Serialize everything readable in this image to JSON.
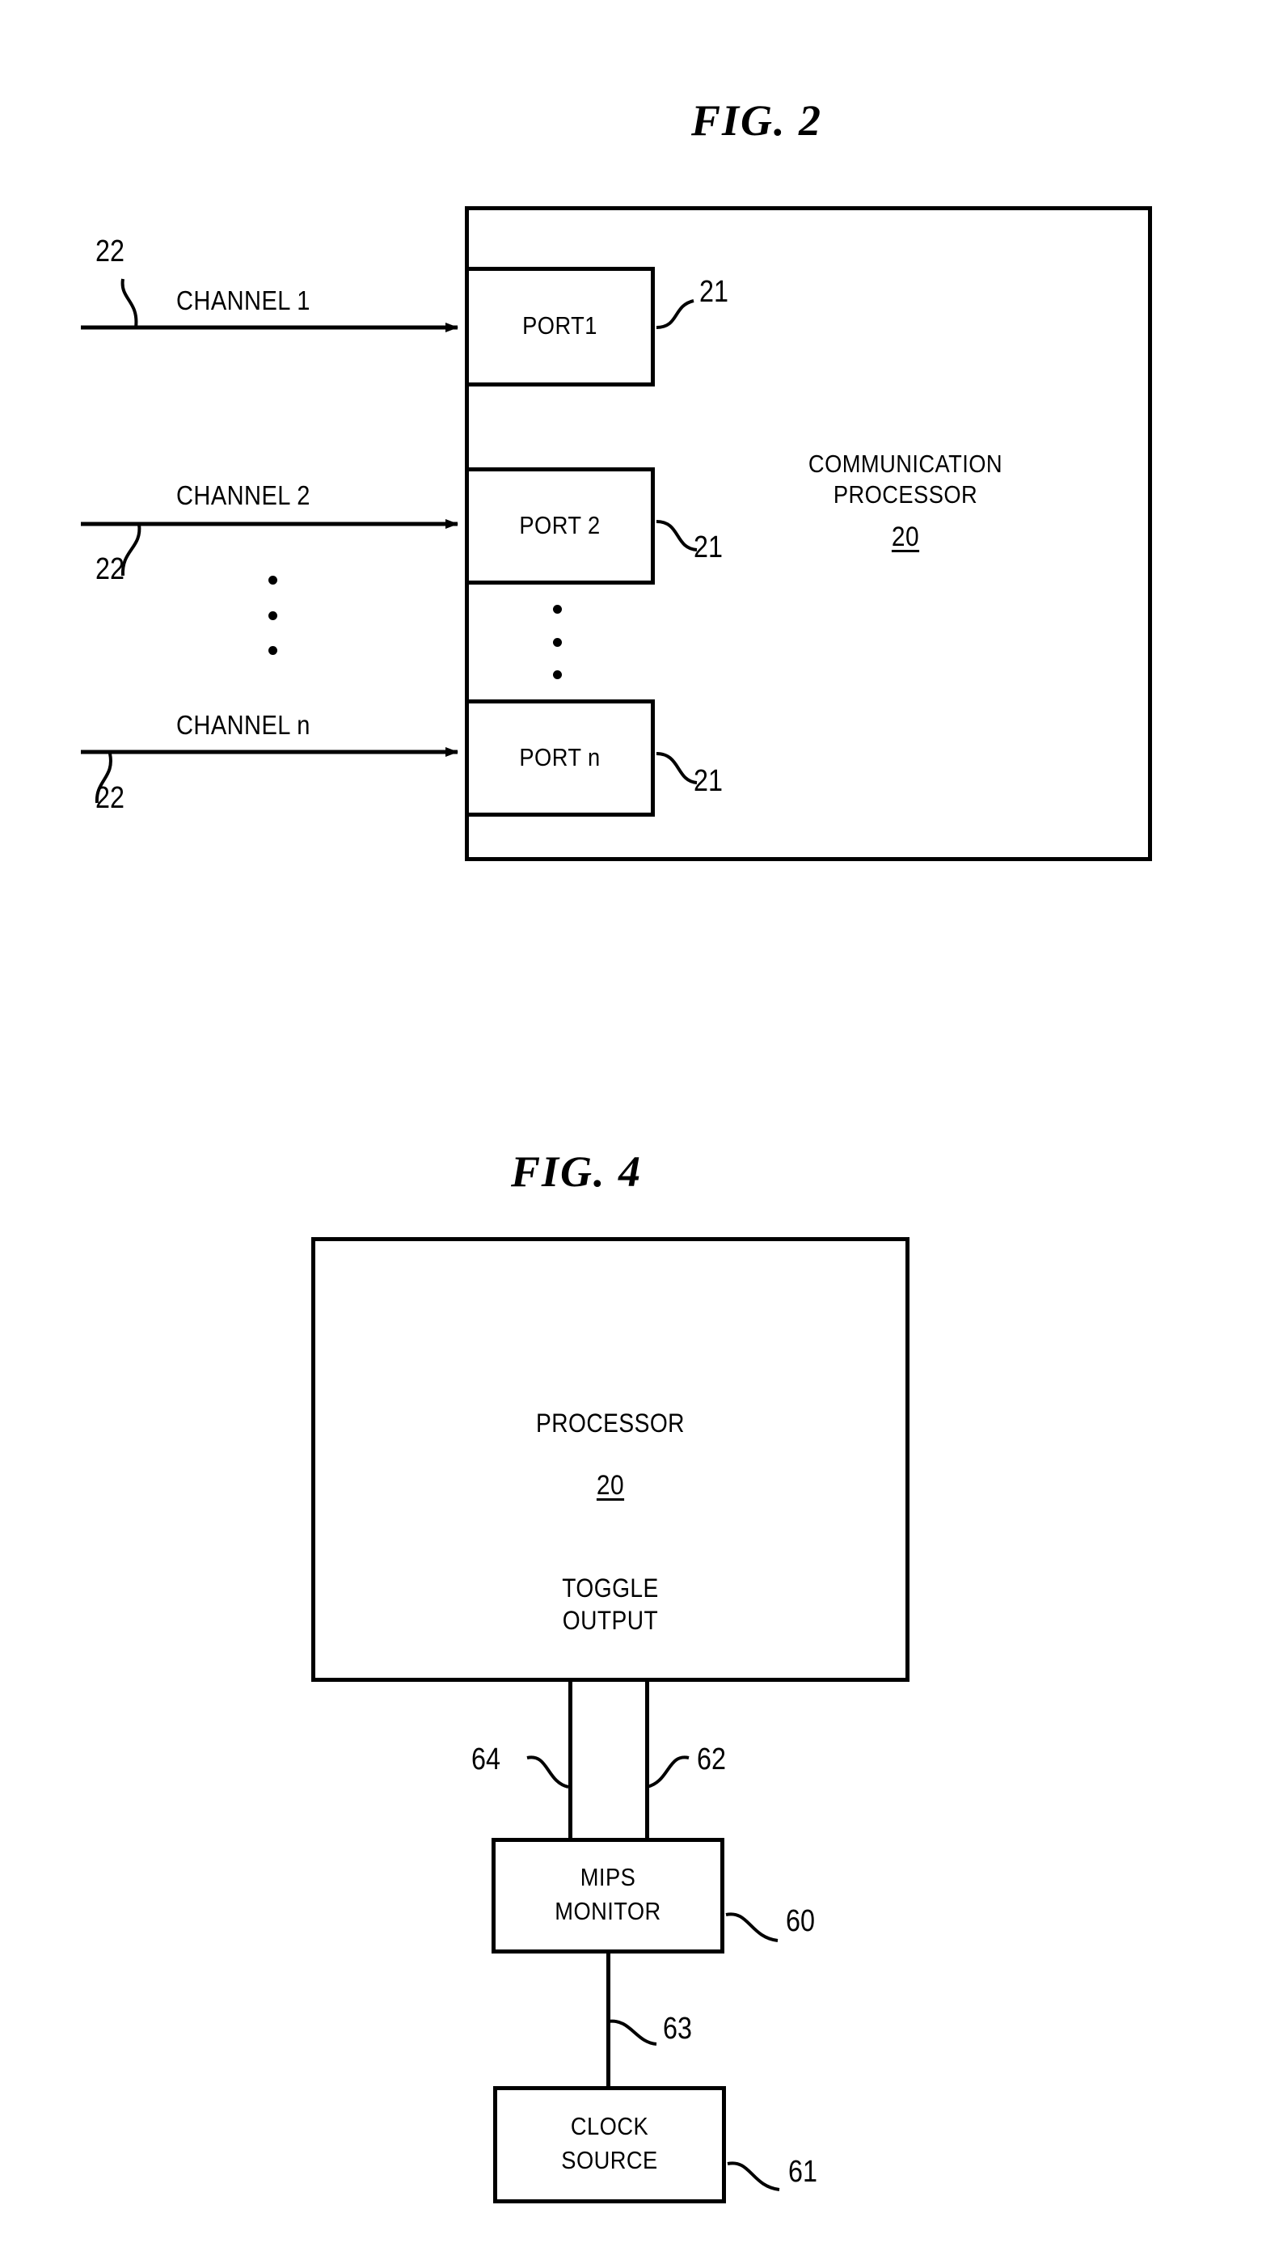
{
  "figures": [
    {
      "id": "fig2",
      "title": "FIG. 2",
      "main_block": {
        "label_line1": "COMMUNICATION",
        "label_line2": "PROCESSOR",
        "ref": "20"
      },
      "ports": [
        {
          "label": "PORT1",
          "ref": "21"
        },
        {
          "label": "PORT 2",
          "ref": "21"
        },
        {
          "label": "PORT n",
          "ref": "21"
        }
      ],
      "channels": [
        {
          "label": "CHANNEL 1",
          "ref": "22"
        },
        {
          "label": "CHANNEL 2",
          "ref": "22"
        },
        {
          "label": "CHANNEL n",
          "ref": "22"
        }
      ],
      "ellipsis_glyph": "vertical-dots"
    },
    {
      "id": "fig4",
      "title": "FIG. 4",
      "processor": {
        "label": "PROCESSOR",
        "ref": "20",
        "output_line1": "TOGGLE",
        "output_line2": "OUTPUT"
      },
      "mips_monitor": {
        "label_line1": "MIPS",
        "label_line2": "MONITOR",
        "ref": "60"
      },
      "clock_source": {
        "label_line1": "CLOCK",
        "label_line2": "SOURCE",
        "ref": "61"
      },
      "connectors": [
        {
          "ref": "64",
          "name": "toggle-feedback-line"
        },
        {
          "ref": "62",
          "name": "toggle-output-line"
        },
        {
          "ref": "63",
          "name": "clock-line"
        }
      ]
    }
  ],
  "colors": {
    "ink": "#000000",
    "paper": "#ffffff"
  }
}
